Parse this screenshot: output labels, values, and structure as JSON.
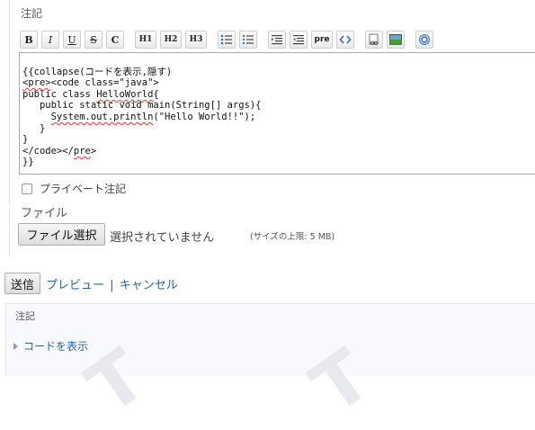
{
  "notes_section": {
    "legend": "注記"
  },
  "toolbar": {
    "buttons": [
      {
        "name": "bold",
        "label": "B"
      },
      {
        "name": "italic",
        "label": "I"
      },
      {
        "name": "underline",
        "label": "U"
      },
      {
        "name": "strikethrough",
        "label": "S"
      },
      {
        "name": "code",
        "label": "C"
      },
      {
        "name": "h1",
        "label": "H1"
      },
      {
        "name": "h2",
        "label": "H2"
      },
      {
        "name": "h3",
        "label": "H3"
      },
      {
        "name": "pre",
        "label": "pre"
      }
    ]
  },
  "editor": {
    "lines": [
      "{{collapse(コードを表示,隠す)",
      "<pre><code class=\"java\">",
      "public class HelloWorld{",
      "   public static void main(String[] args){",
      "     System.out.println(\"Hello World!!\");",
      "   }",
      "}",
      "</code></pre>",
      "}}"
    ]
  },
  "private_note": {
    "label": "プライベート注記"
  },
  "file_section": {
    "legend": "ファイル",
    "choose_button": "ファイル選択",
    "status": "選択されていません",
    "max_size": "(サイズの上限: 5 MB)"
  },
  "actions": {
    "submit": "送信",
    "preview": "プレビュー",
    "separator": "|",
    "cancel": "キャンセル"
  },
  "preview_panel": {
    "legend": "注記",
    "toggle": "コードを表示"
  },
  "colors": {
    "link": "#2a6496",
    "panel_bg": "#f8f9fd"
  }
}
